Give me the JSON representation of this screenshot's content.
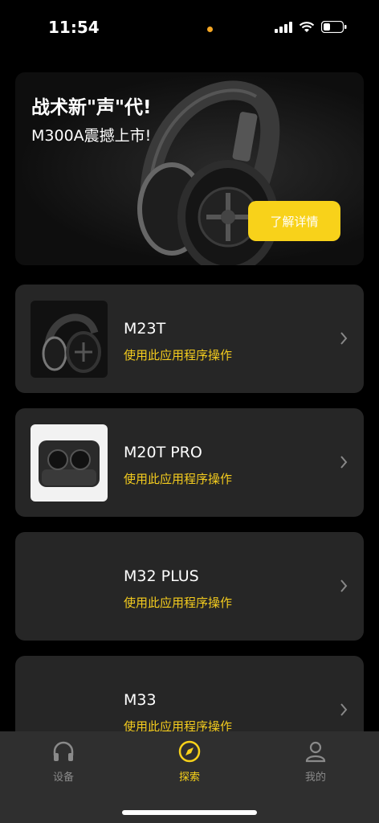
{
  "status_bar": {
    "time": "11:54"
  },
  "banner": {
    "title": "战术新\"声\"代!",
    "subtitle": "M300A震撼上市!",
    "button_label": "了解详情"
  },
  "devices": [
    {
      "name": "M23T",
      "subtitle": "使用此应用程序操作"
    },
    {
      "name": "M20T PRO",
      "subtitle": "使用此应用程序操作"
    },
    {
      "name": "M32 PLUS",
      "subtitle": "使用此应用程序操作"
    },
    {
      "name": "M33",
      "subtitle": "使用此应用程序操作"
    }
  ],
  "tab_bar": {
    "tabs": [
      {
        "label": "设备",
        "icon": "headphones-icon",
        "active": false
      },
      {
        "label": "探索",
        "icon": "compass-icon",
        "active": true
      },
      {
        "label": "我的",
        "icon": "person-icon",
        "active": false
      }
    ]
  },
  "colors": {
    "accent": "#f8d21a",
    "card": "#262626",
    "tab_bar": "#2f2f2f",
    "background": "#000000"
  }
}
